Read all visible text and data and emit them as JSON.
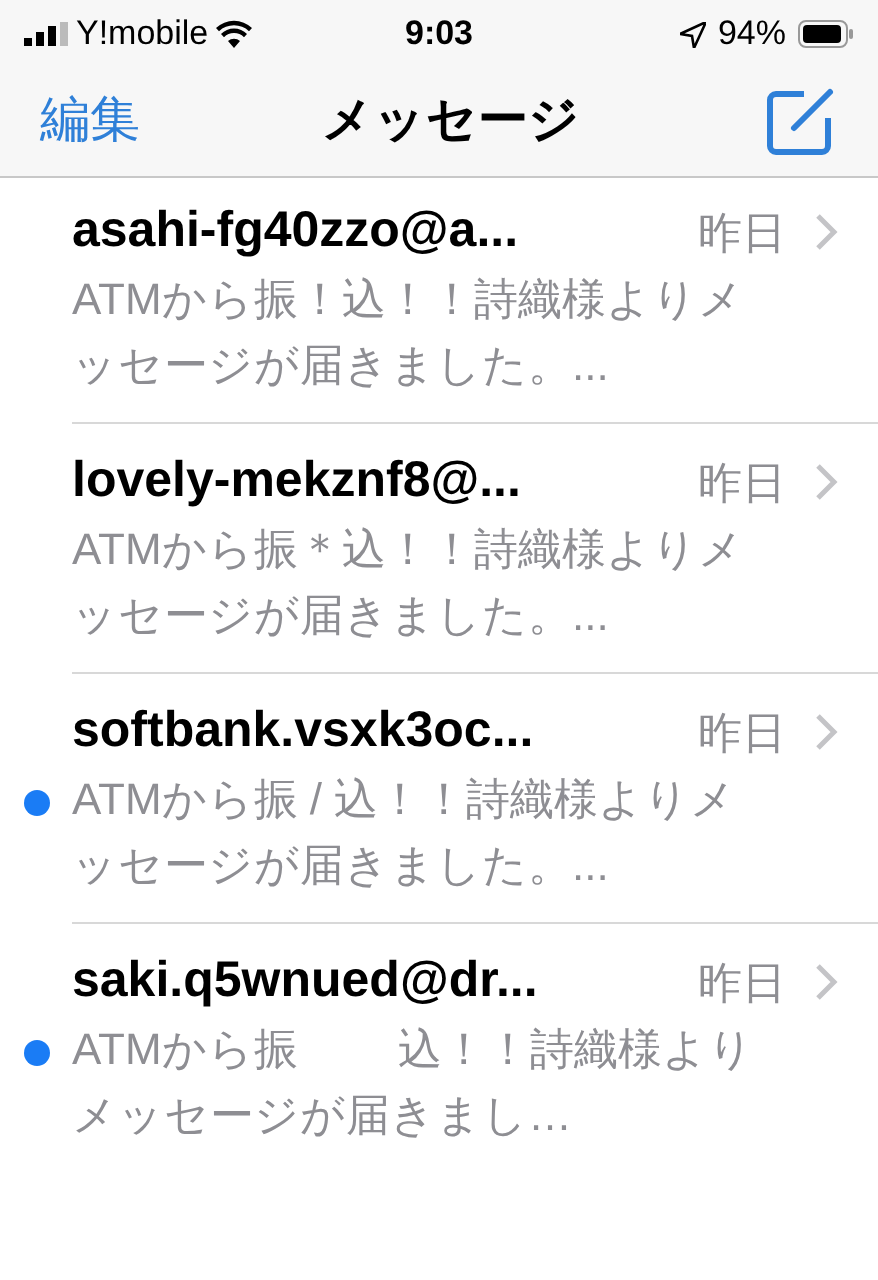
{
  "status_bar": {
    "carrier": "Y!mobile",
    "time": "9:03",
    "battery": "94%"
  },
  "nav": {
    "edit": "編集",
    "title": "メッセージ"
  },
  "messages": [
    {
      "sender": "asahi-fg40zzo@a...",
      "date": "昨日",
      "preview": "ATMから振！込！！詩織様よりメッセージが届きました。...",
      "unread": false
    },
    {
      "sender": "lovely-mekznf8@...",
      "date": "昨日",
      "preview": "ATMから振＊込！！詩織様よりメッセージが届きました。...",
      "unread": false
    },
    {
      "sender": "softbank.vsxk3oc...",
      "date": "昨日",
      "preview": "ATMから振 / 込！！詩織様よりメッセージが届きました。...",
      "unread": true
    },
    {
      "sender": "saki.q5wnued@dr...",
      "date": "昨日",
      "preview": "ATMから振　　 込！！詩織様よりメッセージが届きまし…",
      "unread": true
    }
  ]
}
